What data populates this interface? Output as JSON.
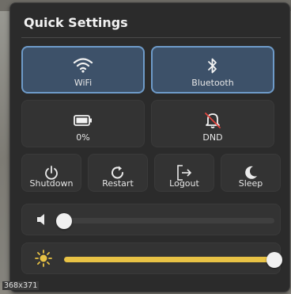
{
  "panel": {
    "title": "Quick Settings"
  },
  "toggles": [
    {
      "label": "WiFi",
      "icon": "wifi-icon",
      "active": true
    },
    {
      "label": "Bluetooth",
      "icon": "bluetooth-icon",
      "active": true
    },
    {
      "label": "0%",
      "icon": "battery-icon",
      "active": false
    },
    {
      "label": "DND",
      "icon": "bell-off-icon",
      "active": false
    }
  ],
  "power": [
    {
      "label": "Shutdown",
      "icon": "power-icon"
    },
    {
      "label": "Restart",
      "icon": "restart-icon"
    },
    {
      "label": "Logout",
      "icon": "logout-icon"
    },
    {
      "label": "Sleep",
      "icon": "moon-icon"
    }
  ],
  "volume": {
    "icon": "speaker-icon",
    "level": 0
  },
  "brightness": {
    "icon": "sun-icon",
    "level": 100
  },
  "colors": {
    "active_tile": "#3d5169",
    "active_border": "#6e9bc9",
    "slider_fill": "#e8c245"
  },
  "size_tag": "368x371"
}
